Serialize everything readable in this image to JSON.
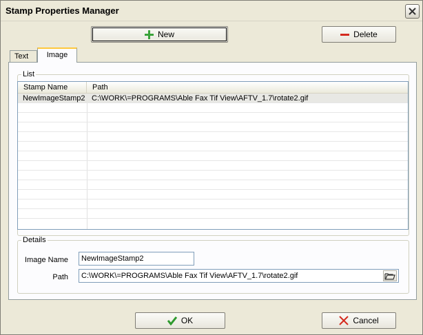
{
  "window": {
    "title": "Stamp Properties Manager"
  },
  "toolbar": {
    "new_label": "New",
    "delete_label": "Delete"
  },
  "tabs": [
    {
      "label": "Text"
    },
    {
      "label": "Image",
      "active": true
    }
  ],
  "list": {
    "group_label": "List",
    "columns": [
      "Stamp Name",
      "Path"
    ],
    "rows": [
      {
        "name": "NewImageStamp2",
        "path": "C:\\WORK\\=PROGRAMS\\Able Fax Tif View\\AFTV_1.7\\rotate2.gif"
      }
    ]
  },
  "details": {
    "group_label": "Details",
    "image_name_label": "Image Name",
    "image_name_value": "NewImageStamp2",
    "path_label": "Path",
    "path_value": "C:\\WORK\\=PROGRAMS\\Able Fax Tif View\\AFTV_1.7\\rotate2.gif"
  },
  "footer": {
    "ok_label": "OK",
    "cancel_label": "Cancel"
  },
  "colors": {
    "new_icon": "#3aa33a",
    "delete_icon": "#d42a1e",
    "ok_icon": "#2e9a2e",
    "cancel_icon": "#d42a1e",
    "tab_highlight": "#ffc83c"
  },
  "icons": {
    "new": "plus-icon",
    "delete": "minus-icon",
    "ok": "checkmark-icon",
    "cancel": "x-icon",
    "browse": "open-folder-icon",
    "close": "close-icon"
  }
}
